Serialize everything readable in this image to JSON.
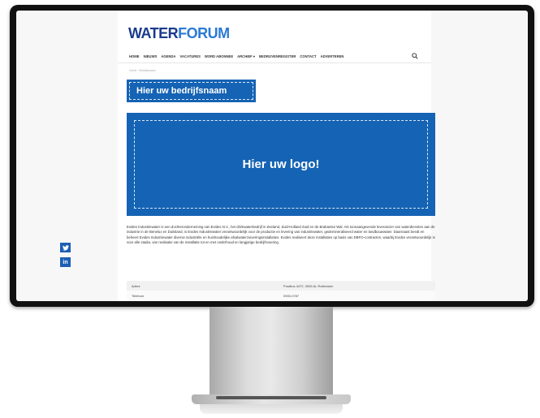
{
  "site": {
    "logo_part1": "WATER",
    "logo_part2": "FORUM"
  },
  "nav": {
    "items": [
      {
        "label": "HOME"
      },
      {
        "label": "NIEUWS"
      },
      {
        "label": "AGENDA"
      },
      {
        "label": "VACATURES"
      },
      {
        "label": "WORD ABONNEE"
      },
      {
        "label": "ARCHIEF ▾"
      },
      {
        "label": "BEDRIJVENREGISTER"
      },
      {
        "label": "CONTACT"
      },
      {
        "label": "ADVERTEREN"
      }
    ],
    "search_icon": "search-icon"
  },
  "breadcrumb": "Home › Bedrijfsnaam",
  "company": {
    "name": "Hier uw bedrijfsnaam",
    "logo_placeholder": "Hier uw logo!"
  },
  "description": "Evides Industriewater is een dochteronderneming van Evides N.V., het drinkwaterbedrijf in Zeeland, Zuid-Holland Zuid en de Brabantse Wal. Als toonaangevende leverancier van waterdiensten aan de industrie in de Benelux en Duitsland, is Evides Industriewater verantwoordelijk voor de productie en levering van industriewater, gedemineraliseerd water en landbouwwater. Daarnaast beedt en beheert Evides Industriewater diverse industriële en huishoudelijke afvalwaterzuiveringsinstallaties. Evides realiseert deze installaties op basis van DBFO-contracten, waarbij Evides verantwoordelijk is voor alle stadia, van realisatie van de installatie tot en met onderhoud en langjarige bedrijfsvoering.",
  "info": {
    "rows": [
      {
        "label": "Adres",
        "value": "Postbus 4472, 3006 AL Rotterdam"
      },
      {
        "label": "Telefoon",
        "value": "0900-0787"
      }
    ]
  },
  "social": {
    "twitter": "twitter-icon",
    "linkedin_label": "in"
  },
  "colors": {
    "brand_dark": "#1a3a8c",
    "brand_light": "#2a7ad6",
    "placeholder_blue": "#1563b4"
  }
}
